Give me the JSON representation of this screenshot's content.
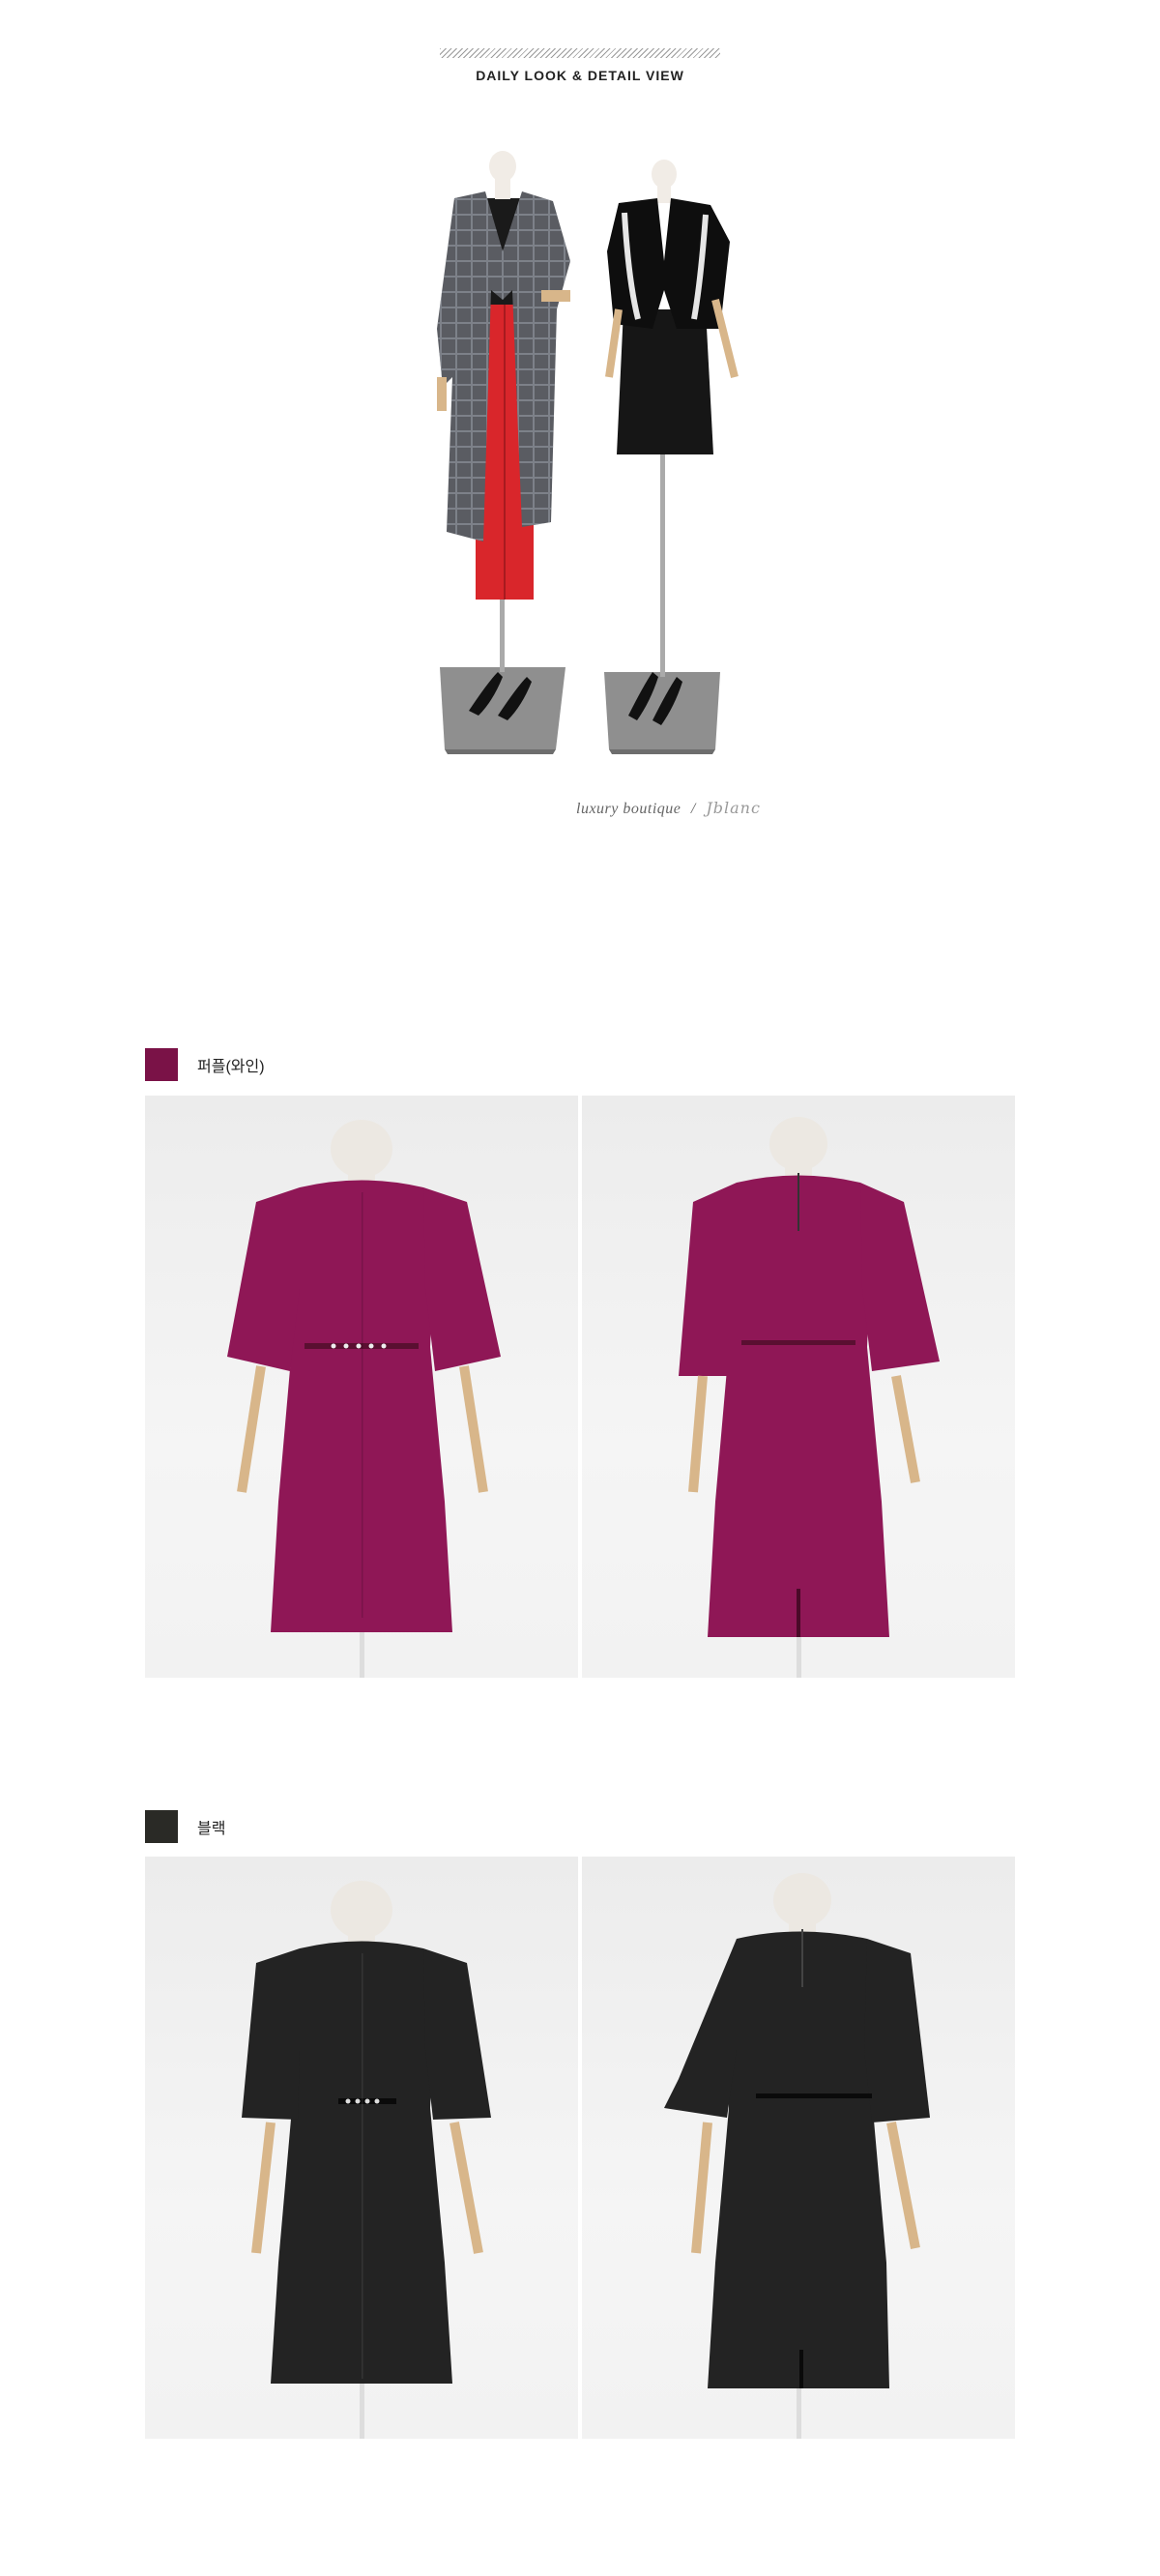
{
  "header": {
    "title": "DAILY LOOK & DETAIL VIEW"
  },
  "daily_look": {
    "image_alt_icon": "mannequins-photo",
    "tagline": "luxury boutique",
    "signature": "Jblanc"
  },
  "colors": [
    {
      "name": "퍼플(와인)",
      "swatch_hex": "#7a1247",
      "dress_hex": "#8f1756",
      "front_view_icon": "dress-front-photo",
      "back_view_icon": "dress-back-photo"
    },
    {
      "name": "블랙",
      "swatch_hex": "#2a2a26",
      "dress_hex": "#232323",
      "front_view_icon": "dress-front-photo",
      "back_view_icon": "dress-back-photo"
    }
  ]
}
